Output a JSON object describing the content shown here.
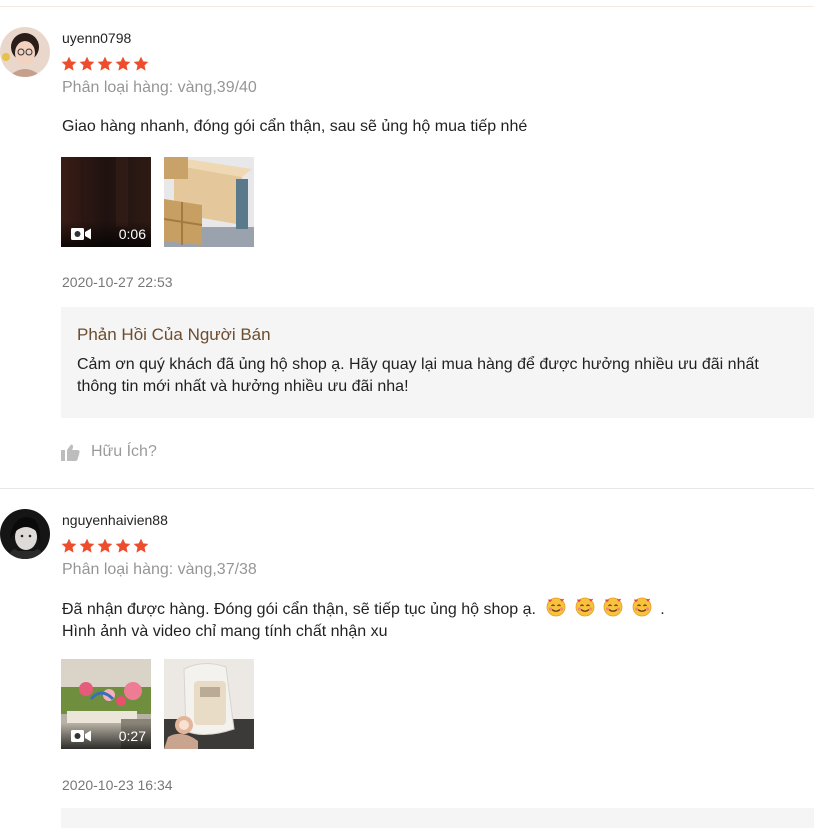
{
  "reviews": [
    {
      "username": "uyenn0798",
      "rating": 5,
      "variation": "Phân loại hàng: vàng,39/40",
      "comment_lines": [
        "Giao hàng nhanh, đóng gói cẩn thận, sau sẽ ủng hộ mua tiếp nhé"
      ],
      "video_duration": "0:06",
      "timestamp": "2020-10-27 22:53",
      "seller_reply": {
        "title": "Phản Hồi Của Người Bán",
        "lines": [
          "Cảm ơn quý khách đã ủng hộ shop ạ. Hãy quay lại mua hàng để được hưởng nhiều ưu đãi nhất",
          "thông tin mới nhất và hưởng nhiều ưu đãi nha!"
        ]
      },
      "helpful_label": "Hữu Ích?"
    },
    {
      "username": "nguyenhaivien88",
      "rating": 5,
      "variation": "Phân loại hàng: vàng,37/38",
      "comment_lines": [
        "Đã nhận được hàng. Đóng gói cẩn thận, sẽ tiếp tục ủng hộ shop ạ.",
        "Hình ảnh và video chỉ mang tính chất nhận xu"
      ],
      "comment_suffix": ".",
      "emoji": "smiling-face-with-hearts",
      "emoji_count": 4,
      "video_duration": "0:27",
      "timestamp": "2020-10-23 16:34"
    }
  ],
  "colors": {
    "star": "#ee4d2d",
    "seller_title": "#6b4d2f",
    "muted": "#8a8a8a"
  },
  "icons": [
    "star-icon",
    "video-camera-icon",
    "thumbs-up-icon",
    "smiling-face-with-hearts-emoji"
  ]
}
